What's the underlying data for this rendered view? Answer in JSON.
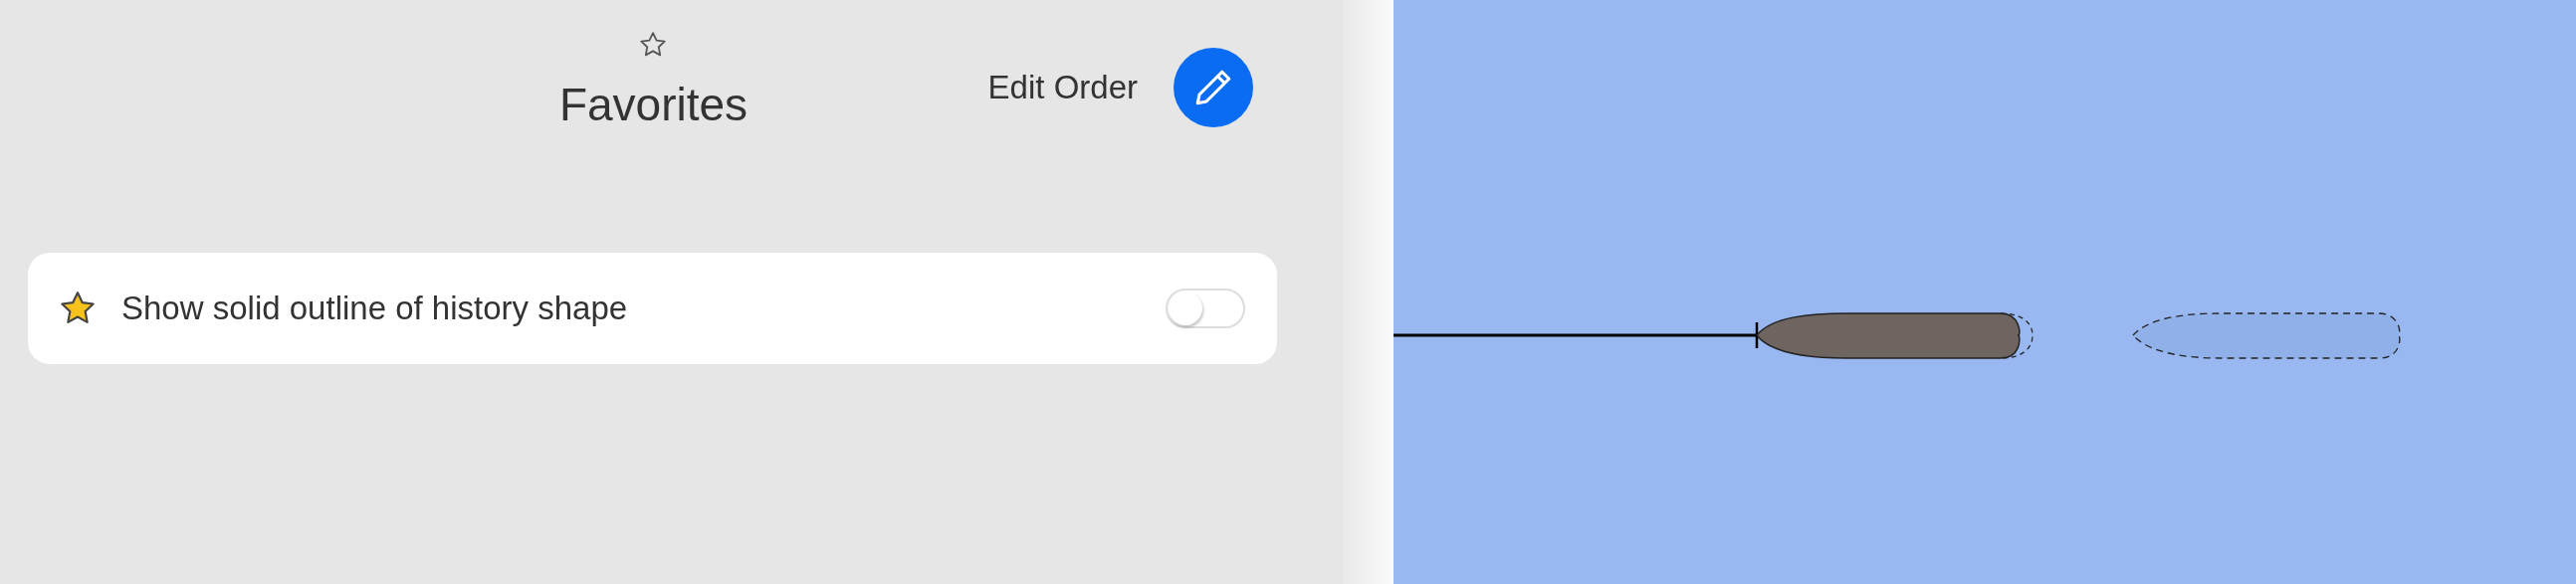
{
  "header": {
    "title": "Favorites",
    "edit_label": "Edit Order"
  },
  "settings": [
    {
      "kind": "toggle",
      "label": "Show solid outline of history shape",
      "on": false
    }
  ]
}
